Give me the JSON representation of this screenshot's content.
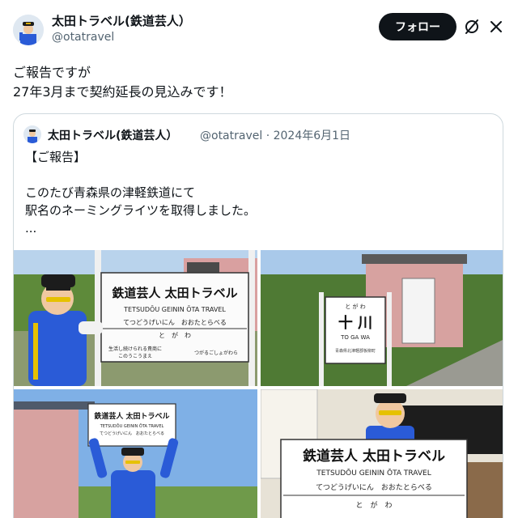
{
  "author": {
    "display_name": "太田トラベル(鉄道芸人）",
    "handle": "@otatravel",
    "follow_label": "フォロー"
  },
  "post": {
    "lines": [
      "ご報告ですが",
      "27年3月まで契約延長の見込みです！"
    ]
  },
  "quote": {
    "display_name": "太田トラベル(鉄道芸人）",
    "meta": "@otatravel · 2024年6月1日",
    "lines": [
      "【ご報告】",
      "",
      "このたび青森県の津軽鉄道にて",
      "駅名のネーミングライツを取得しました。",
      "..."
    ]
  },
  "sign": {
    "title": "鉄道芸人 太田トラベル",
    "romaji": "TETSUDŌU GEININ ŌTA TRAVEL",
    "kana": "てつどうげいにん　おおたとらべる",
    "sub": "と　が　わ",
    "left_note": "生活し続けられる貴商に",
    "left_note2": "このうこうまえ",
    "right_note": "つがるごしょがわら"
  },
  "station_sign": {
    "kana": "と が わ",
    "name": "十 川",
    "romaji": "TO GA WA",
    "small": "青森県北津軽郡板柳町"
  },
  "icons": {
    "grok": "grok-icon",
    "close": "close-icon"
  },
  "colors": {
    "follow_bg": "#0f1419",
    "uniform": "#2a5bd7",
    "sky": "#a9c9ea"
  }
}
